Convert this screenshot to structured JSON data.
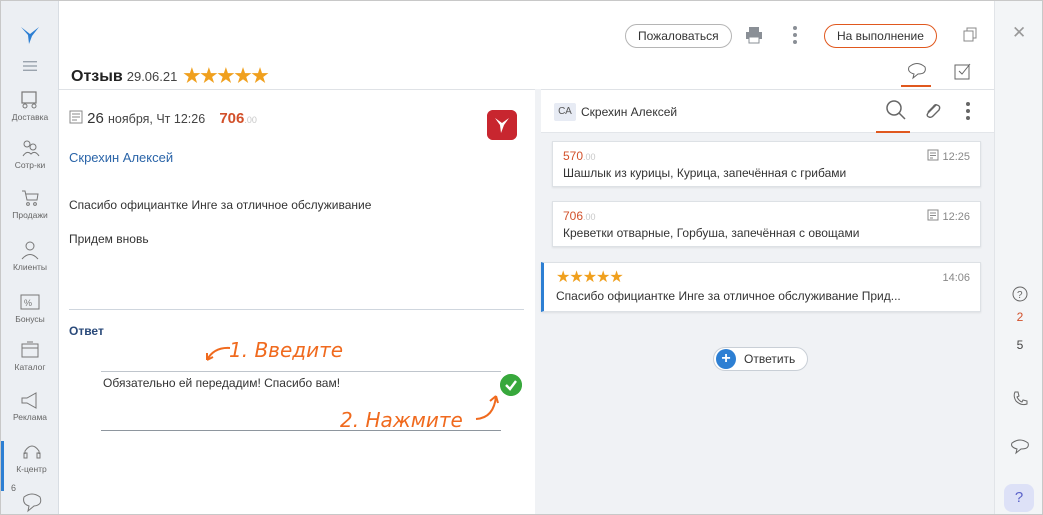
{
  "nav": {
    "items": [
      {
        "label": "Доставка",
        "icon": "delivery-icon"
      },
      {
        "label": "Сотр-ки",
        "icon": "employees-icon"
      },
      {
        "label": "Продажи",
        "icon": "sales-icon"
      },
      {
        "label": "Клиенты",
        "icon": "clients-icon"
      },
      {
        "label": "Бонусы",
        "icon": "bonus-icon"
      },
      {
        "label": "Каталог",
        "icon": "catalog-icon"
      },
      {
        "label": "Реклама",
        "icon": "ads-icon"
      },
      {
        "label": "К-центр",
        "icon": "headset-icon"
      }
    ],
    "bottom_badge": "6"
  },
  "header": {
    "complain_label": "Пожаловаться",
    "exec_label": "На выполнение",
    "title": "Отзыв",
    "date": "29.06.21",
    "stars": "★★★★★"
  },
  "review": {
    "day": "26",
    "month_time": "ноября, Чт 12:26",
    "amount": "706",
    "amount_kop": ".00",
    "author": "Скрехин Алексей",
    "text1": "Спасибо официантке Инге за отличное обслуживание",
    "text2": "Придем вновь",
    "answer_label": "Ответ",
    "answer_text": "Обязательно ей передадим! Спасибо вам!",
    "annotation1": "1. Введите",
    "annotation2": "2. Нажмите"
  },
  "chat": {
    "avatar_initials": "СА",
    "author": "Скрехин Алексей",
    "orders": [
      {
        "sum": "570",
        "kop": ".00",
        "time": "12:25",
        "desc": "Шашлык из курицы, Курица, запечённая с грибами"
      },
      {
        "sum": "706",
        "kop": ".00",
        "time": "12:26",
        "desc": "Креветки отварные, Горбуша, запечённая с овощами"
      }
    ],
    "review_card": {
      "stars": "★★★★★",
      "time": "14:06",
      "text": "Спасибо официантке Инге за отличное обслуживание Прид..."
    },
    "reply_label": "Ответить"
  },
  "rail": {
    "counter1": "2",
    "counter2": "5",
    "help": "?"
  },
  "colors": {
    "accent_orange": "#e0581e",
    "star": "#f0a01e",
    "link_blue": "#2a64a8",
    "primary_blue": "#2d7fd3",
    "success_green": "#38a83c",
    "price_red": "#d2502a"
  }
}
